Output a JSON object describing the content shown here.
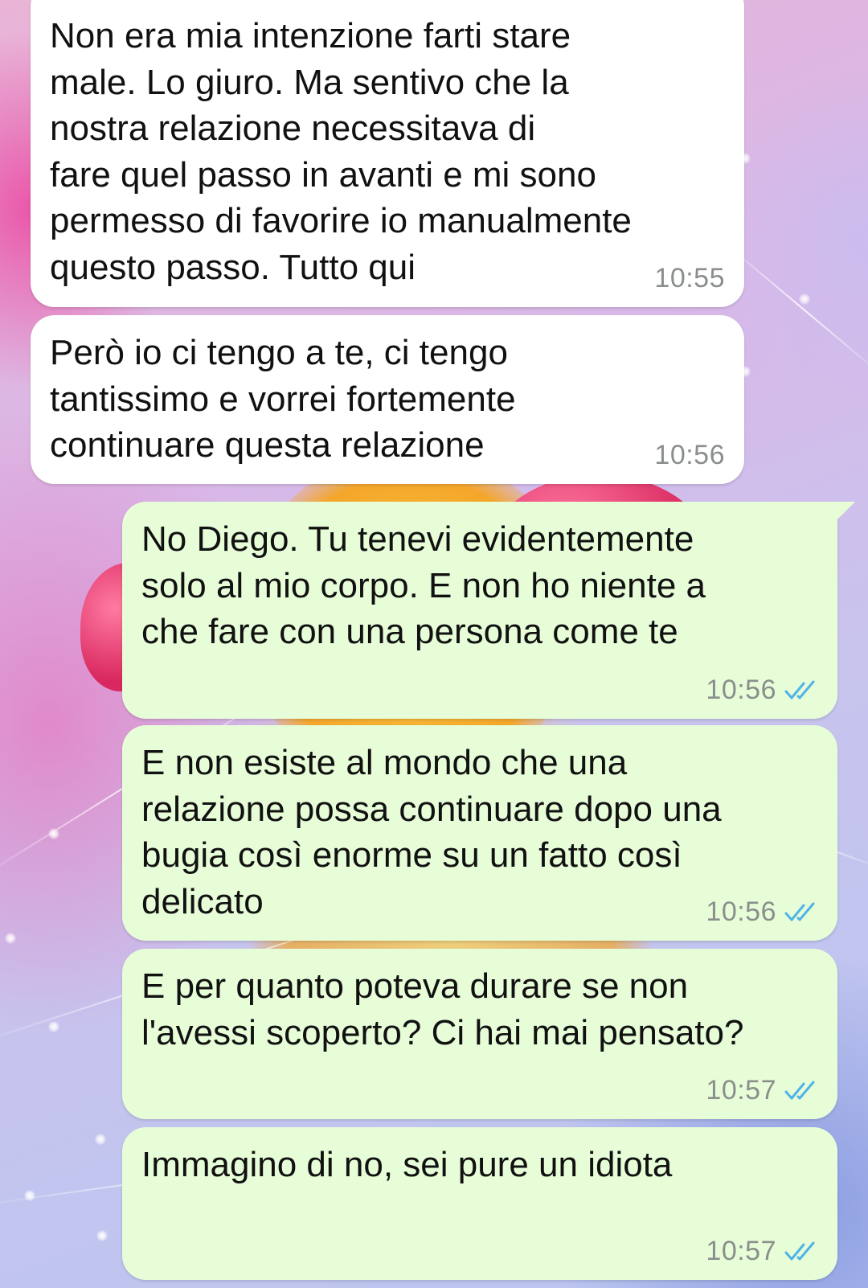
{
  "conversation": {
    "messages": [
      {
        "id": "m1",
        "direction": "incoming",
        "text": "Non era mia intenzione farti stare\nmale. Lo giuro. Ma sentivo che la\nnostra relazione necessitava di\nfare quel passo in avanti e mi sono\npermesso di favorire io manualmente\nquesto passo. Tutto qui",
        "time": "10:55"
      },
      {
        "id": "m2",
        "direction": "incoming",
        "text": "Però io ci tengo a te, ci tengo\ntantissimo e vorrei fortemente\ncontinuare questa relazione",
        "time": "10:56"
      },
      {
        "id": "m3",
        "direction": "outgoing",
        "text": "No Diego. Tu tenevi evidentemente\nsolo al mio corpo. E non ho niente a\nche fare con una persona come te",
        "time": "10:56",
        "status_icon": "double-check-read-icon"
      },
      {
        "id": "m4",
        "direction": "outgoing",
        "text": "E non esiste al mondo che una\nrelazione possa continuare dopo una\nbugia così enorme su un fatto così\ndelicato",
        "time": "10:56",
        "status_icon": "double-check-read-icon"
      },
      {
        "id": "m5",
        "direction": "outgoing",
        "text": "E per quanto poteva durare se non\nl'avessi scoperto? Ci hai mai pensato?",
        "time": "10:57",
        "status_icon": "double-check-read-icon"
      },
      {
        "id": "m6",
        "direction": "outgoing",
        "text": "Immagino di no, sei pure un idiota",
        "time": "10:57",
        "status_icon": "double-check-read-icon"
      }
    ]
  },
  "colors": {
    "incoming_bubble": "#ffffff",
    "outgoing_bubble": "#e7fdd8",
    "timestamp": "#8a8f8c",
    "read_ticks": "#4fb3e8"
  }
}
